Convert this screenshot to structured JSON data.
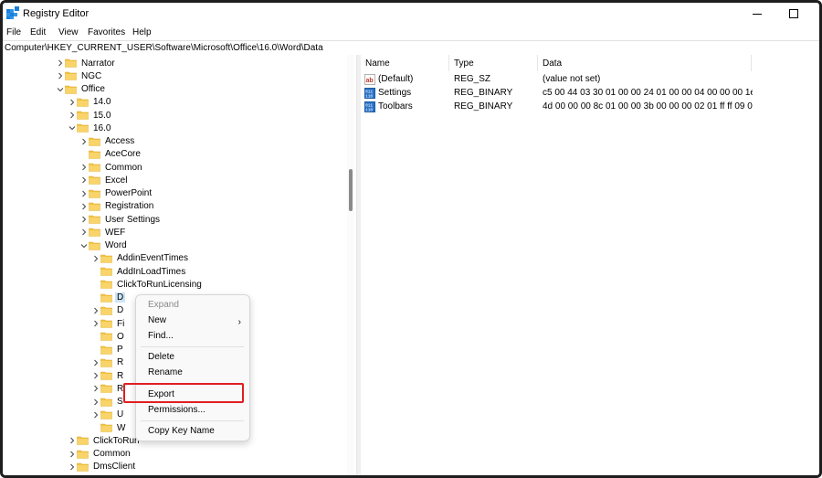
{
  "window": {
    "title": "Registry Editor"
  },
  "menu": [
    "File",
    "Edit",
    "View",
    "Favorites",
    "Help"
  ],
  "address": "Computer\\HKEY_CURRENT_USER\\Software\\Microsoft\\Office\\16.0\\Word\\Data",
  "tree": [
    {
      "label": "Narrator",
      "expanded": false,
      "has_children": true
    },
    {
      "label": "NGC",
      "expanded": false,
      "has_children": true
    },
    {
      "label": "Office",
      "expanded": true,
      "has_children": true
    },
    {
      "label": "14.0",
      "expanded": false,
      "has_children": true
    },
    {
      "label": "15.0",
      "expanded": false,
      "has_children": true
    },
    {
      "label": "16.0",
      "expanded": true,
      "has_children": true
    },
    {
      "label": "Access",
      "expanded": false,
      "has_children": true
    },
    {
      "label": "AceCore",
      "expanded": false,
      "has_children": false
    },
    {
      "label": "Common",
      "expanded": false,
      "has_children": true
    },
    {
      "label": "Excel",
      "expanded": false,
      "has_children": true
    },
    {
      "label": "PowerPoint",
      "expanded": false,
      "has_children": true
    },
    {
      "label": "Registration",
      "expanded": false,
      "has_children": true
    },
    {
      "label": "User Settings",
      "expanded": false,
      "has_children": true
    },
    {
      "label": "WEF",
      "expanded": false,
      "has_children": true
    },
    {
      "label": "Word",
      "expanded": true,
      "has_children": true
    },
    {
      "label": "AddinEventTimes",
      "expanded": false,
      "has_children": true
    },
    {
      "label": "AddInLoadTimes",
      "expanded": false,
      "has_children": false
    },
    {
      "label": "ClickToRunLicensing",
      "expanded": false,
      "has_children": false
    },
    {
      "label": "D",
      "expanded": false,
      "has_children": false,
      "selected": true
    },
    {
      "label": "D",
      "expanded": false,
      "has_children": true
    },
    {
      "label": "Fi",
      "expanded": false,
      "has_children": true
    },
    {
      "label": "O",
      "expanded": false,
      "has_children": false
    },
    {
      "label": "P",
      "expanded": false,
      "has_children": false
    },
    {
      "label": "R",
      "expanded": false,
      "has_children": true
    },
    {
      "label": "R",
      "expanded": false,
      "has_children": true
    },
    {
      "label": "R",
      "expanded": false,
      "has_children": true
    },
    {
      "label": "S",
      "expanded": false,
      "has_children": true
    },
    {
      "label": "U",
      "expanded": false,
      "has_children": true
    },
    {
      "label": "W",
      "expanded": false,
      "has_children": false
    },
    {
      "label": "ClickToRun",
      "expanded": false,
      "has_children": true
    },
    {
      "label": "Common",
      "expanded": false,
      "has_children": true
    },
    {
      "label": "DmsClient",
      "expanded": false,
      "has_children": true
    }
  ],
  "values": {
    "headers": {
      "name": "Name",
      "type": "Type",
      "data": "Data"
    },
    "rows": [
      {
        "name": "(Default)",
        "type": "REG_SZ",
        "data": "(value not set)",
        "icon": "string-value-icon"
      },
      {
        "name": "Settings",
        "type": "REG_BINARY",
        "data": "c5 00 44 03 30 01 00 00 24 01 00 00 04 00 00 00 1e ...",
        "icon": "binary-value-icon"
      },
      {
        "name": "Toolbars",
        "type": "REG_BINARY",
        "data": "4d 00 00 00 8c 01 00 00 3b 00 00 00 02 01 ff ff 09 0...",
        "icon": "binary-value-icon"
      }
    ]
  },
  "context_menu": {
    "expand": "Expand",
    "new": "New",
    "find": "Find...",
    "delete": "Delete",
    "rename": "Rename",
    "export": "Export",
    "permissions": "Permissions...",
    "copy_key_name": "Copy Key Name"
  },
  "colors": {
    "folder": "#f4c542",
    "selection": "#cce4f7",
    "highlight": "#e01e22"
  }
}
